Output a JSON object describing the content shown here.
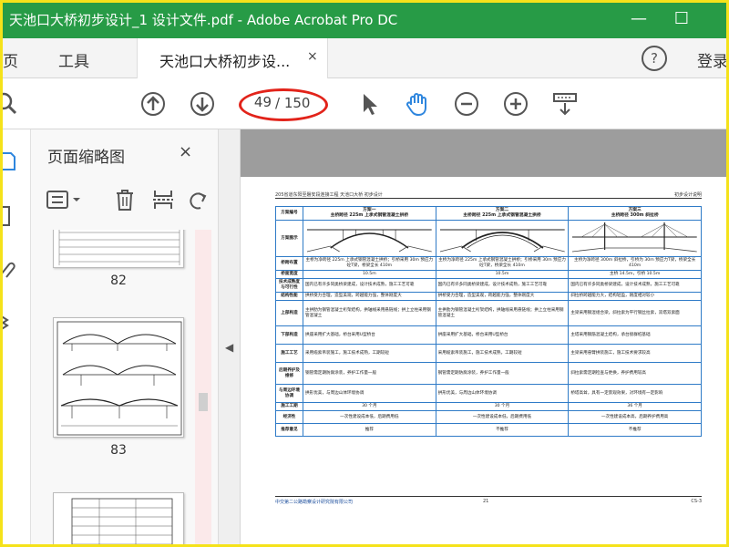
{
  "window": {
    "title": "天池口大桥初步设计_1 设计文件.pdf - Adobe Acrobat Pro DC",
    "minimize": "—",
    "maximize": "☐"
  },
  "menubar": {
    "home": "主页",
    "tools": "工具",
    "doc_tab": "天池口大桥初步设...",
    "tab_close": "×",
    "help": "?",
    "signin": "登录"
  },
  "toolbar": {
    "current_page": "49",
    "total_pages": "/ 150"
  },
  "thumbnails": {
    "title": "页面缩略图",
    "close": "×",
    "pages": [
      {
        "label": "82"
      },
      {
        "label": "83"
      }
    ]
  },
  "document": {
    "header_left": "205省道东阳至磐安段连接工程 天池口大桥 初步设计",
    "header_right": "初步设计说明",
    "columns": [
      {
        "title": "方案一",
        "subtitle": "主桥跨径 225m 上承式钢管混凝土拱桥"
      },
      {
        "title": "方案二",
        "subtitle": "主桥跨径 225m 上承式钢管混凝土拱桥"
      },
      {
        "title": "方案三",
        "subtitle": "主桥跨径 300m 斜拉桥"
      }
    ],
    "rows": [
      {
        "label": "方案编号",
        "cells": [
          "方案一",
          "方案二",
          "方案三"
        ]
      },
      {
        "label": "方案图示",
        "cells": [
          "",
          "",
          ""
        ]
      },
      {
        "label": "桥跨布置",
        "cells": [
          "主桥为净跨径 225m 上承式钢管混凝土拱桥；引桥采用 30m 预应力砼T梁，桥梁全长 410m",
          "主桥为净跨径 225m 上承式钢管混凝土拱桥；引桥采用 30m 预应力砼T梁，桥梁全长 410m",
          "主桥为净跨径 300m 斜拉桥，引桥为 30m 预应力T梁，桥梁全长 410m"
        ]
      },
      {
        "label": "桥面宽度",
        "cells": [
          "10.5m",
          "10.5m",
          "主桥 14.5m，引桥 10.5m"
        ]
      },
      {
        "label": "技术成熟度与可行性",
        "cells": [
          "国内已有许多同类桥梁建成，设计技术成熟，施工工艺可靠",
          "国内已有许多同类桥梁建成，设计技术成熟，施工工艺可靠",
          "国内已有许多同类桥梁建成，设计技术成熟，施工工艺可靠"
        ]
      },
      {
        "label": "结构性能",
        "cells": [
          "拱桥受力合理，造型美观，跨越能力强，整体刚度大",
          "拱桥受力合理，造型美观，跨越能力强，整体刚度大",
          "斜拉桥跨越能力大，结构轻盈，刚度相对较小"
        ]
      },
      {
        "label": "上部构造",
        "cells": [
          "主拱肋为钢管混凝土桁架结构，拱轴线采用悬链线；拱上立柱采用钢管混凝土",
          "主拱肋为钢管混凝土桁架结构，拱轴线采用悬链线；拱上立柱采用钢管混凝土",
          "主梁采用钢混组合梁，斜拉索为平行钢丝拉索，双塔双索面"
        ]
      },
      {
        "label": "下部构造",
        "cells": [
          "拱座采用扩大基础，桥台采用U型桥台",
          "拱座采用扩大基础，桥台采用U型桥台",
          "主塔采用钢筋混凝土结构，承台接群桩基础"
        ]
      },
      {
        "label": "施工工艺",
        "cells": [
          "采用缆索吊装施工，施工技术成熟，工期较短",
          "采用缆索吊装施工，施工技术成熟，工期较短",
          "主梁采用悬臂拼装施工，施工技术要求较高"
        ]
      },
      {
        "label": "后期养护及维修",
        "cells": [
          "钢管需定期防腐涂装，养护工作量一般",
          "钢管需定期防腐涂装，养护工作量一般",
          "斜拉索需定期检查与更换，养护费用较高"
        ]
      },
      {
        "label": "与周边环境协调",
        "cells": [
          "拱形优美，与周边山体环境协调",
          "拱形优美，与周边山体环境协调",
          "桥塔高耸，具有一定景观效果，对环境有一定影响"
        ]
      },
      {
        "label": "施工工期",
        "cells": [
          "30 个月",
          "30 个月",
          "36 个月"
        ]
      },
      {
        "label": "经济性",
        "cells": [
          "一次性建设成本低，后期费用低",
          "一次性建设成本低，后期费用低",
          "一次性建设成本高，后期养护费用高"
        ]
      },
      {
        "label": "推荐意见",
        "cells": [
          "推荐",
          "不推荐",
          "不推荐"
        ]
      }
    ],
    "footer_left": "中交第二公路勘察设计研究院有限公司",
    "footer_center": "21",
    "footer_right": "CS-3"
  }
}
